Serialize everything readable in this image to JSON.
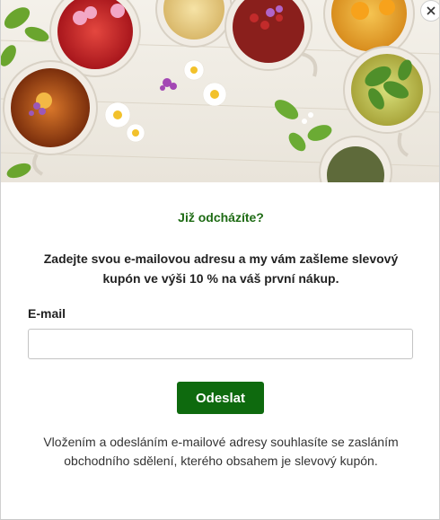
{
  "popup": {
    "close_icon": "close-icon",
    "hero_image": "tea-cups-with-herbs-and-flowers",
    "heading": "Již odcházíte?",
    "lead": "Zadejte svou e-mailovou adresu a my vám zašleme slevový kupón ve výši 10 % na váš první nákup.",
    "email_label": "E-mail",
    "email_value": "",
    "email_placeholder": "",
    "submit_label": "Odeslat",
    "disclaimer": "Vložením a odesláním e-mailové adresy souhlasíte se zasláním obchodního sdělení, kterého obsahem je slevový kupón.",
    "colors": {
      "heading": "#1e6b14",
      "button": "#0e6a0e",
      "background": "#ffffff"
    }
  }
}
